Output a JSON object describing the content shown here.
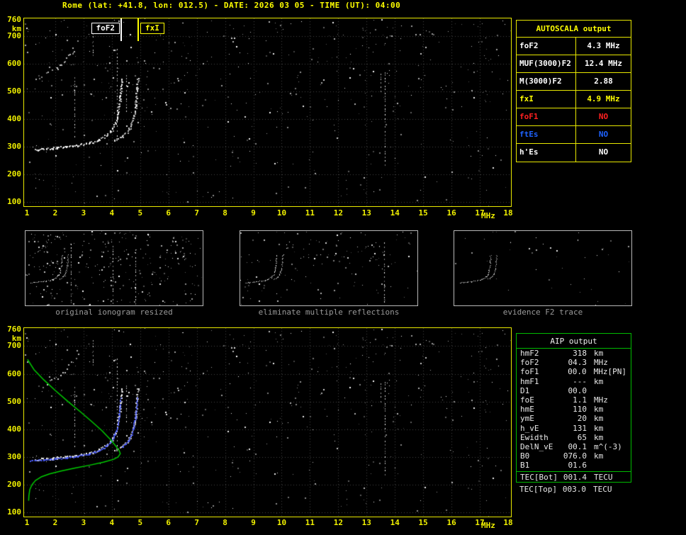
{
  "window": {
    "title": "Rome (lat: +41.8, lon: 012.5) - DATE: 2026 03 05 - TIME (UT): 04:00"
  },
  "colors": {
    "background": "#000000",
    "axis_yellow": "#f0f000",
    "border_yellow": "#e8e800",
    "grid": "#444444",
    "trace_white": "#ffffff",
    "fitted_blue": "#4a5cff",
    "profile_green": "#00cc00",
    "caption_gray": "#9a9a9a",
    "table_red": "#ff2020",
    "table_blue": "#1e62ff",
    "aip_green": "#00bb00"
  },
  "autoscala_table": {
    "title": "AUTOSCALA output",
    "rows": [
      {
        "label": "foF2",
        "value": "4.3 MHz",
        "color": "#ffffff"
      },
      {
        "label": "MUF(3000)F2",
        "value": "12.4 MHz",
        "color": "#ffffff"
      },
      {
        "label": "M(3000)F2",
        "value": "2.88",
        "color": "#ffffff"
      },
      {
        "label": "fxI",
        "value": "4.9 MHz",
        "color": "#ffff00"
      },
      {
        "label": "foF1",
        "value": "NO",
        "color": "#ff2020"
      },
      {
        "label": "ftEs",
        "value": "NO",
        "color": "#1e62ff"
      },
      {
        "label": "h'Es",
        "value": "NO",
        "color": "#ffffff"
      }
    ]
  },
  "thumbnails": [
    {
      "caption": "original ionogram resized"
    },
    {
      "caption": "eliminate multiple reflections"
    },
    {
      "caption": "evidence F2 trace"
    }
  ],
  "aip_table": {
    "title": "AIP output",
    "rows": [
      {
        "label": "hmF2",
        "value": "318",
        "unit": "km"
      },
      {
        "label": "foF2",
        "value": "04.3",
        "unit": "MHz"
      },
      {
        "label": "foF1",
        "value": "00.0",
        "unit": "MHz",
        "extra": "[PN]"
      },
      {
        "label": "hmF1",
        "value": "---",
        "unit": "km"
      },
      {
        "label": "D1",
        "value": "00.0",
        "unit": ""
      },
      {
        "label": "foE",
        "value": "1.1",
        "unit": "MHz"
      },
      {
        "label": "hmE",
        "value": "110",
        "unit": "km"
      },
      {
        "label": "ymE",
        "value": "20",
        "unit": "km"
      },
      {
        "label": "h_vE",
        "value": "131",
        "unit": "km"
      },
      {
        "label": "Ewidth",
        "value": "65",
        "unit": "km"
      },
      {
        "label": "DelN_vE",
        "value": "00.1",
        "unit": "m^(-3)"
      },
      {
        "label": "B0",
        "value": "076.0",
        "unit": "km"
      },
      {
        "label": "B1",
        "value": "01.6",
        "unit": ""
      },
      {
        "label": "TEC[Bot]",
        "value": "001.4",
        "unit": "TECU",
        "sep_above": true
      },
      {
        "label": "TEC[Top]",
        "value": "003.0",
        "unit": "TECU",
        "outside_box": true
      }
    ]
  },
  "chart_data": [
    {
      "id": "scaled-ionogram",
      "type": "scatter",
      "xlabel": "MHz",
      "ylabel": "km",
      "xlim": [
        1,
        18
      ],
      "ylim": [
        90,
        760
      ],
      "x_ticks": [
        1,
        2,
        3,
        4,
        5,
        6,
        7,
        8,
        9,
        10,
        11,
        12,
        13,
        14,
        15,
        16,
        17,
        18
      ],
      "y_ticks": [
        760,
        700,
        600,
        500,
        400,
        300,
        200,
        100
      ],
      "grid": true,
      "markers": [
        {
          "label": "foF2",
          "frequency_mhz": 4.3,
          "color": "#ffffff",
          "label_side": "left"
        },
        {
          "label": "fxI",
          "frequency_mhz": 4.9,
          "color": "#ffff00",
          "label_side": "right"
        }
      ],
      "series": [
        {
          "name": "f2-trace-ordinary",
          "role": "trace",
          "color": "#ffffff",
          "size": 2,
          "jitter": 1.5,
          "points": [
            [
              1.25,
              291
            ],
            [
              1.6,
              294
            ],
            [
              2.0,
              297
            ],
            [
              2.4,
              301
            ],
            [
              2.8,
              307
            ],
            [
              3.2,
              315
            ],
            [
              3.5,
              325
            ],
            [
              3.8,
              342
            ],
            [
              4.0,
              363
            ],
            [
              4.1,
              385
            ],
            [
              4.18,
              412
            ],
            [
              4.24,
              445
            ],
            [
              4.28,
              482
            ],
            [
              4.3,
              515
            ],
            [
              4.32,
              550
            ]
          ]
        },
        {
          "name": "f2-trace-extraordinary",
          "role": "trace",
          "color": "#e0e0e0",
          "size": 2,
          "jitter": 1.5,
          "f_offset": 0.58,
          "f_min": 4.05,
          "points_ref": "f2-trace-ordinary"
        },
        {
          "name": "second-hop-echo",
          "role": "trace",
          "color": "#d0d0d0",
          "size": 2,
          "jitter": 2.5,
          "sparse": 0.45,
          "points": [
            [
              1.25,
              548
            ],
            [
              1.6,
              562
            ],
            [
              1.95,
              585
            ],
            [
              2.3,
              612
            ],
            [
              2.6,
              648
            ],
            [
              2.85,
              688
            ]
          ]
        }
      ]
    },
    {
      "id": "reconstructed-ionogram-with-profile",
      "type": "scatter",
      "xlabel": "MHz",
      "ylabel": "km",
      "xlim": [
        1,
        18
      ],
      "ylim": [
        90,
        760
      ],
      "x_ticks": [
        1,
        2,
        3,
        4,
        5,
        6,
        7,
        8,
        9,
        10,
        11,
        12,
        13,
        14,
        15,
        16,
        17,
        18
      ],
      "y_ticks": [
        760,
        700,
        600,
        500,
        400,
        300,
        200,
        100
      ],
      "grid": true,
      "markers": [],
      "series": [
        {
          "name": "f2-trace-ordinary",
          "role": "trace",
          "color": "#ffffff",
          "size": 2,
          "jitter": 1.5,
          "points": [
            [
              1.25,
              291
            ],
            [
              1.6,
              294
            ],
            [
              2.0,
              297
            ],
            [
              2.4,
              301
            ],
            [
              2.8,
              307
            ],
            [
              3.2,
              315
            ],
            [
              3.5,
              325
            ],
            [
              3.8,
              342
            ],
            [
              4.0,
              363
            ],
            [
              4.1,
              385
            ],
            [
              4.18,
              412
            ],
            [
              4.24,
              445
            ],
            [
              4.28,
              482
            ],
            [
              4.3,
              515
            ],
            [
              4.32,
              550
            ]
          ]
        },
        {
          "name": "f2-trace-extraordinary",
          "role": "trace",
          "color": "#e0e0e0",
          "size": 2,
          "jitter": 1.5,
          "f_offset": 0.58,
          "f_min": 4.05,
          "points_ref": "f2-trace-ordinary"
        },
        {
          "name": "second-hop-echo",
          "role": "trace",
          "color": "#d0d0d0",
          "size": 2,
          "jitter": 2.5,
          "sparse": 0.4,
          "points": [
            [
              1.25,
              548
            ],
            [
              1.6,
              562
            ],
            [
              1.95,
              585
            ],
            [
              2.3,
              612
            ],
            [
              2.6,
              648
            ],
            [
              2.85,
              688
            ]
          ]
        },
        {
          "name": "autoscala-restored-trace",
          "role": "trace",
          "color": "#4a5cff",
          "size": 2,
          "jitter": 0.8,
          "step": 2,
          "points": [
            [
              1.1,
              288
            ],
            [
              1.6,
              292
            ],
            [
              2.0,
              295
            ],
            [
              2.4,
              299
            ],
            [
              2.8,
              305
            ],
            [
              3.2,
              313
            ],
            [
              3.5,
              323
            ],
            [
              3.8,
              340
            ],
            [
              4.0,
              361
            ],
            [
              4.1,
              383
            ],
            [
              4.18,
              410
            ],
            [
              4.24,
              443
            ],
            [
              4.28,
              480
            ],
            [
              4.3,
              513
            ]
          ]
        },
        {
          "name": "autoscala-restored-trace-x",
          "role": "trace",
          "color": "#4a5cff",
          "size": 2,
          "jitter": 0.8,
          "step": 2,
          "f_offset": 0.58,
          "f_min": 4.3,
          "points_ref": "autoscala-restored-trace"
        },
        {
          "name": "electron-density-profile",
          "role": "line",
          "color": "#00cc00",
          "width": 1.5,
          "points": [
            [
              1.02,
              652
            ],
            [
              1.25,
              615
            ],
            [
              1.6,
              578
            ],
            [
              2.0,
              540
            ],
            [
              2.45,
              500
            ],
            [
              2.9,
              462
            ],
            [
              3.3,
              427
            ],
            [
              3.65,
              395
            ],
            [
              3.95,
              363
            ],
            [
              4.15,
              338
            ],
            [
              4.26,
              322
            ],
            [
              4.3,
              312
            ],
            [
              4.22,
              300
            ],
            [
              4.05,
              291
            ],
            [
              3.7,
              281
            ],
            [
              3.2,
              270
            ],
            [
              2.7,
              260
            ],
            [
              2.2,
              249
            ],
            [
              1.8,
              239
            ],
            [
              1.5,
              228
            ],
            [
              1.3,
              215
            ],
            [
              1.18,
              200
            ],
            [
              1.1,
              182
            ],
            [
              1.07,
              160
            ],
            [
              1.06,
              142
            ]
          ]
        }
      ]
    }
  ]
}
